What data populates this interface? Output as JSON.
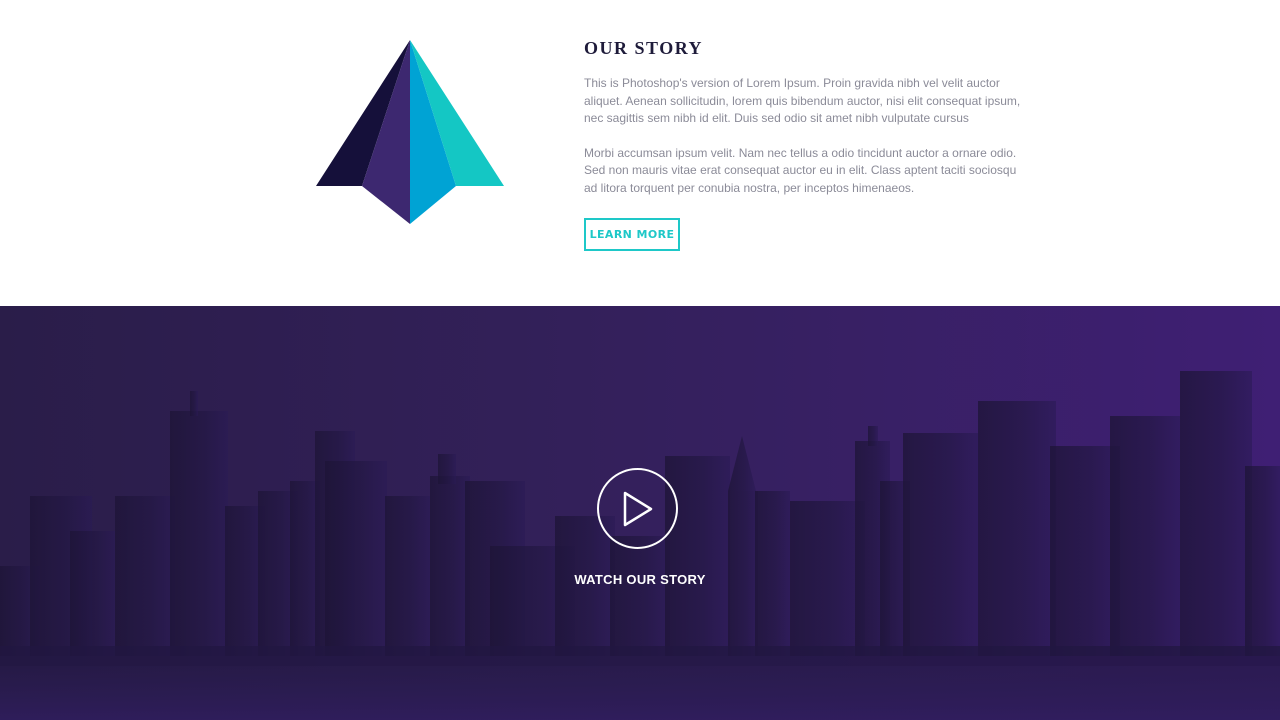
{
  "story": {
    "title": "OUR STORY",
    "paragraph_1": "This is Photoshop's version  of Lorem Ipsum. Proin gravida nibh vel velit auctor\naliquet. Aenean sollicitudin, lorem quis bibendum auctor, nisi elit consequat ipsum,\nnec sagittis sem nibh id elit. Duis sed odio sit amet nibh vulputate cursus",
    "paragraph_2": "Morbi accumsan ipsum velit. Nam nec tellus a odio tincidunt auctor a ornare odio.\nSed non  mauris vitae erat consequat auctor eu in elit. Class aptent taciti sociosqu\nad litora torquent per conubia nostra, per inceptos himenaeos.",
    "button_label": "LEARN MORE"
  },
  "video": {
    "label": "WATCH OUR STORY",
    "icon": "play-icon"
  },
  "colors": {
    "accent": "#1ec8c8",
    "title": "#1e1b3a",
    "body_text": "#8b8b98",
    "overlay_left": "#2a1d49",
    "overlay_right": "#3f1f74"
  },
  "logo": {
    "icon": "pyramid-logo-icon",
    "colors": [
      "#15103a",
      "#3d2870",
      "#00a3d4",
      "#14c7c4"
    ]
  }
}
